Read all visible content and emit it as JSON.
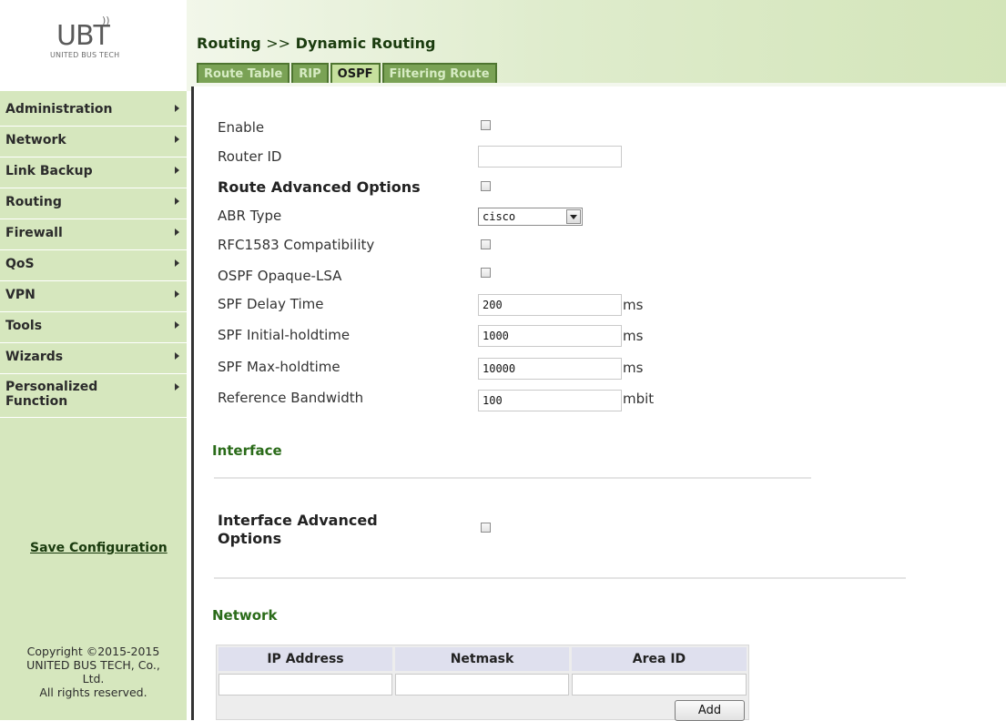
{
  "logo": {
    "mark": "UBT",
    "sub": "UNITED BUS TECH",
    "wave": "))"
  },
  "header": {
    "breadcrumb_section": "Routing",
    "breadcrumb_sep": ">>",
    "breadcrumb_page": "Dynamic Routing"
  },
  "tabs": [
    {
      "label": "Route Table",
      "active": false
    },
    {
      "label": "RIP",
      "active": false
    },
    {
      "label": "OSPF",
      "active": true
    },
    {
      "label": "Filtering Route",
      "active": false
    }
  ],
  "sidebar": {
    "items": [
      {
        "label": "Administration"
      },
      {
        "label": "Network"
      },
      {
        "label": "Link Backup"
      },
      {
        "label": "Routing"
      },
      {
        "label": "Firewall"
      },
      {
        "label": "QoS"
      },
      {
        "label": "VPN"
      },
      {
        "label": "Tools"
      },
      {
        "label": "Wizards"
      },
      {
        "label": "Personalized Function"
      }
    ],
    "save": "Save Configuration",
    "copyright_lines": [
      "Copyright ©2015-2015",
      "UNITED BUS TECH, Co.,",
      "Ltd.",
      "All rights reserved."
    ]
  },
  "form": {
    "enable": {
      "label": "Enable",
      "checked": false
    },
    "router_id": {
      "label": "Router ID",
      "value": ""
    },
    "route_adv": {
      "label": "Route Advanced Options",
      "checked": false
    },
    "abr_type": {
      "label": "ABR Type",
      "value": "cisco"
    },
    "rfc1583": {
      "label": "RFC1583 Compatibility",
      "checked": false
    },
    "opaque": {
      "label": "OSPF Opaque-LSA",
      "checked": false
    },
    "spf_delay": {
      "label": "SPF Delay Time",
      "value": "200",
      "unit": "ms"
    },
    "spf_initial": {
      "label": "SPF Initial-holdtime",
      "value": "1000",
      "unit": "ms"
    },
    "spf_max": {
      "label": "SPF Max-holdtime",
      "value": "10000",
      "unit": "ms"
    },
    "ref_bw": {
      "label": "Reference Bandwidth",
      "value": "100",
      "unit": "mbit"
    }
  },
  "interface": {
    "title": "Interface",
    "adv_label_1": "Interface Advanced",
    "adv_label_2": "Options",
    "checked": false
  },
  "network": {
    "title": "Network",
    "columns": [
      "IP Address",
      "Netmask",
      "Area ID"
    ],
    "add_label": "Add"
  }
}
